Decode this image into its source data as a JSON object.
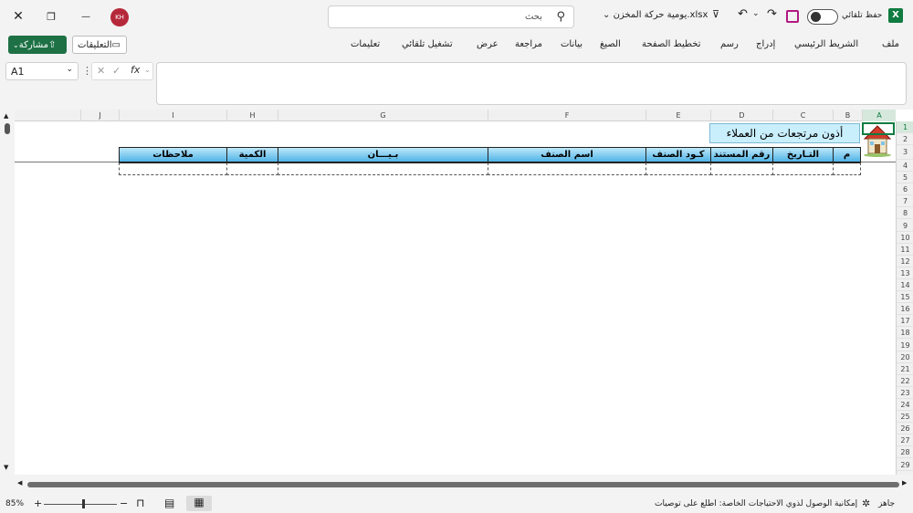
{
  "title_bar": {
    "autosave_label": "حفظ تلقائي",
    "file_name": "يومية حركة المخزن.xlsx",
    "search_placeholder": "بحث",
    "user_initials": "KH",
    "minimize": "—",
    "restore": "❐",
    "close": "✕"
  },
  "ribbon": {
    "tabs": [
      "ملف",
      "الشريط الرئيسي",
      "إدراج",
      "رسم",
      "تخطيط الصفحة",
      "الصيغ",
      "بيانات",
      "مراجعة",
      "عرض",
      "تشغيل تلقائي",
      "تعليمات"
    ],
    "comments_label": "التعليقات",
    "share_label": "مشاركة"
  },
  "formula_bar": {
    "name_box": "A1",
    "fx": "fx",
    "content": ""
  },
  "sheet": {
    "columns": [
      "A",
      "B",
      "C",
      "D",
      "E",
      "F",
      "G",
      "H",
      "I",
      "J"
    ],
    "rows": [
      "1",
      "2",
      "3",
      "4",
      "5",
      "6",
      "7",
      "8",
      "9",
      "10",
      "11",
      "12",
      "13",
      "14",
      "15",
      "16",
      "17",
      "18",
      "19",
      "20",
      "21",
      "22",
      "23",
      "24",
      "25",
      "26",
      "27",
      "28",
      "29"
    ],
    "banner_title": "أذون مرتجعات من العملاء",
    "table_headers": [
      "م",
      "التـاريخ",
      "رقم المستند",
      "كـود الصنف",
      "اسم الصنف",
      "بـيـــان",
      "الكمية",
      "ملاحظات"
    ]
  },
  "status_bar": {
    "ready": "جاهز",
    "accessibility": "إمكانية الوصول لذوي الاحتياجات الخاصة: اطلع على توصيات",
    "zoom": "85%"
  },
  "colors": {
    "header_gradient_top": "#bfe8fb",
    "header_gradient_bottom": "#4fb3e6",
    "share_button": "#1e7145",
    "avatar": "#b5283a",
    "excel_green": "#107c41"
  }
}
